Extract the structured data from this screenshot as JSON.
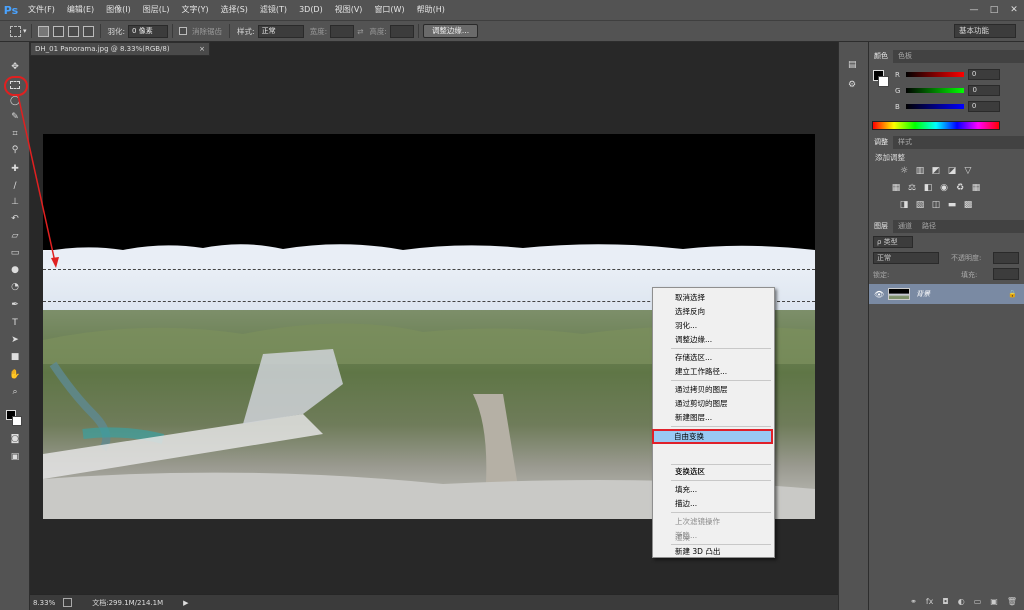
{
  "menubar": {
    "logo": "Ps",
    "items": [
      "文件(F)",
      "编辑(E)",
      "图像(I)",
      "图层(L)",
      "文字(Y)",
      "选择(S)",
      "滤镜(T)",
      "3D(D)",
      "视图(V)",
      "窗口(W)",
      "帮助(H)"
    ]
  },
  "options": {
    "feather_label": "羽化:",
    "feather_value": "0 像素",
    "antialias_label": "消除锯齿",
    "style_label": "样式:",
    "style_value": "正常",
    "width_label": "宽度:",
    "height_label": "高度:",
    "refine_edge_button": "调整边缘...",
    "workspace": "基本功能"
  },
  "document": {
    "tab_title": "DH_01 Panorama.jpg @ 8.33%(RGB/8)",
    "close": "×"
  },
  "status": {
    "zoom": "8.33%",
    "doc_info": "文档:299.1M/214.1M"
  },
  "context_menu": {
    "items": [
      {
        "label": "取消选择",
        "disabled": false
      },
      {
        "label": "选择反向",
        "disabled": false
      },
      {
        "label": "羽化...",
        "disabled": false
      },
      {
        "label": "调整边缘...",
        "disabled": false
      },
      {
        "label": "存储选区...",
        "disabled": false
      },
      {
        "label": "建立工作路径...",
        "disabled": false
      },
      {
        "label": "通过拷贝的图层",
        "disabled": false
      },
      {
        "label": "通过剪切的图层",
        "disabled": false
      },
      {
        "label": "新建图层...",
        "disabled": false
      },
      {
        "label": "自由变换",
        "disabled": false
      },
      {
        "label": "变换选区",
        "disabled": false
      },
      {
        "label": "填充...",
        "disabled": false
      },
      {
        "label": "描边...",
        "disabled": false
      },
      {
        "label": "上次滤镜操作",
        "disabled": true
      },
      {
        "label": "渐隐...",
        "disabled": true
      },
      {
        "label": "渲染",
        "disabled": true
      },
      {
        "label": "新建 3D 凸出",
        "disabled": false
      }
    ],
    "highlighted": "自由变换"
  },
  "color_panel": {
    "tabs": [
      "颜色",
      "色板"
    ],
    "channels": [
      {
        "label": "R",
        "value": "0",
        "color": "#e02020"
      },
      {
        "label": "G",
        "value": "0",
        "color": "#20c020"
      },
      {
        "label": "B",
        "value": "0",
        "color": "#2040e0"
      }
    ]
  },
  "adjustments_panel": {
    "tabs": [
      "调整",
      "样式"
    ],
    "title": "添加调整"
  },
  "layers_panel": {
    "tabs": [
      "图层",
      "通道",
      "路径"
    ],
    "filter_label": "ρ 类型",
    "blend_mode": "正常",
    "opacity_label": "不透明度:",
    "lock_label": "锁定:",
    "fill_label": "填充:",
    "layer_name": "背景"
  },
  "colors": {
    "ui_dark": "#535353",
    "accent_red": "#e02020",
    "highlight_blue": "#99c9f4"
  }
}
